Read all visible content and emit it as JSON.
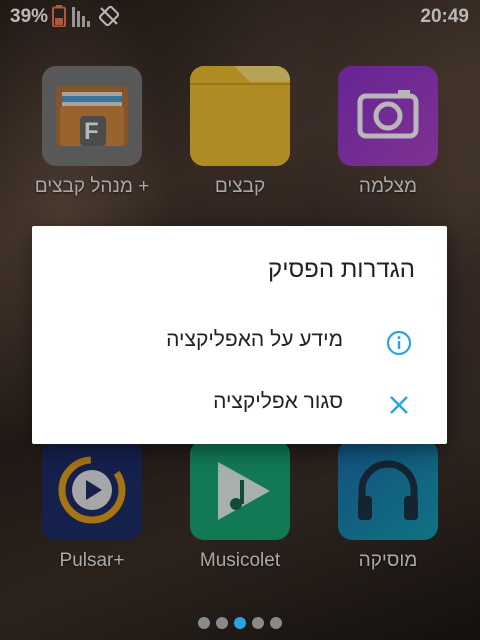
{
  "status_bar": {
    "battery_percent": "39%",
    "time": "20:49",
    "icons": [
      "battery-icon",
      "signal-icon",
      "rotation-lock-icon"
    ]
  },
  "apps_top": [
    {
      "label": "מנהל קבצים +",
      "icon": "file-manager-icon"
    },
    {
      "label": "קבצים",
      "icon": "folder-icon"
    },
    {
      "label": "מצלמה",
      "icon": "camera-icon"
    }
  ],
  "apps_bottom": [
    {
      "label": "Pulsar+",
      "icon": "pulsar-icon"
    },
    {
      "label": "Musicolet",
      "icon": "musicolet-icon"
    },
    {
      "label": "מוסיקה",
      "icon": "headphones-icon"
    }
  ],
  "dialog": {
    "title": "הגדרות הפסיק",
    "items": [
      {
        "label": "מידע על האפליקציה",
        "icon": "info-icon"
      },
      {
        "label": "סגור אפליקציה",
        "icon": "close-icon"
      }
    ],
    "accent_color": "#29a3e3"
  },
  "file_manager_letter": "F",
  "page_indicator": {
    "count": 5,
    "active_index": 2
  }
}
